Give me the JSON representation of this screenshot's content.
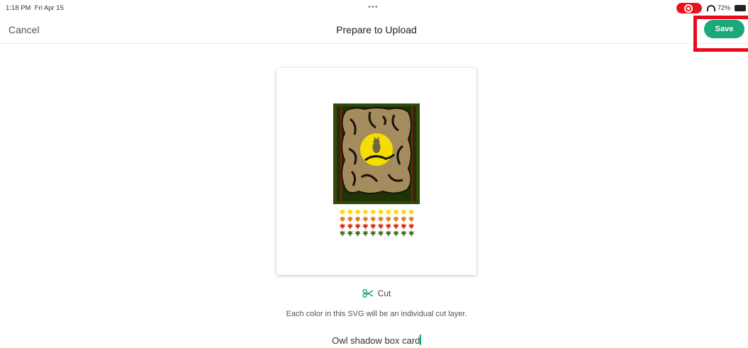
{
  "status_bar": {
    "time": "1:18 PM",
    "date": "Fri Apr 15",
    "dots": "•••",
    "battery": "72%"
  },
  "nav": {
    "cancel_label": "Cancel",
    "title": "Prepare to Upload",
    "save_label": "Save"
  },
  "layer": {
    "mode_label": "Cut",
    "info": "Each color in this SVG will be an individual cut layer."
  },
  "file_name": "Owl shadow box card",
  "colors": {
    "accent": "#1aa979",
    "highlight": "#ea0a1e",
    "recording": "#e8141c",
    "leaf_rows": [
      "#f5dc00",
      "#e07a16",
      "#d8321b",
      "#3f7a16"
    ]
  }
}
